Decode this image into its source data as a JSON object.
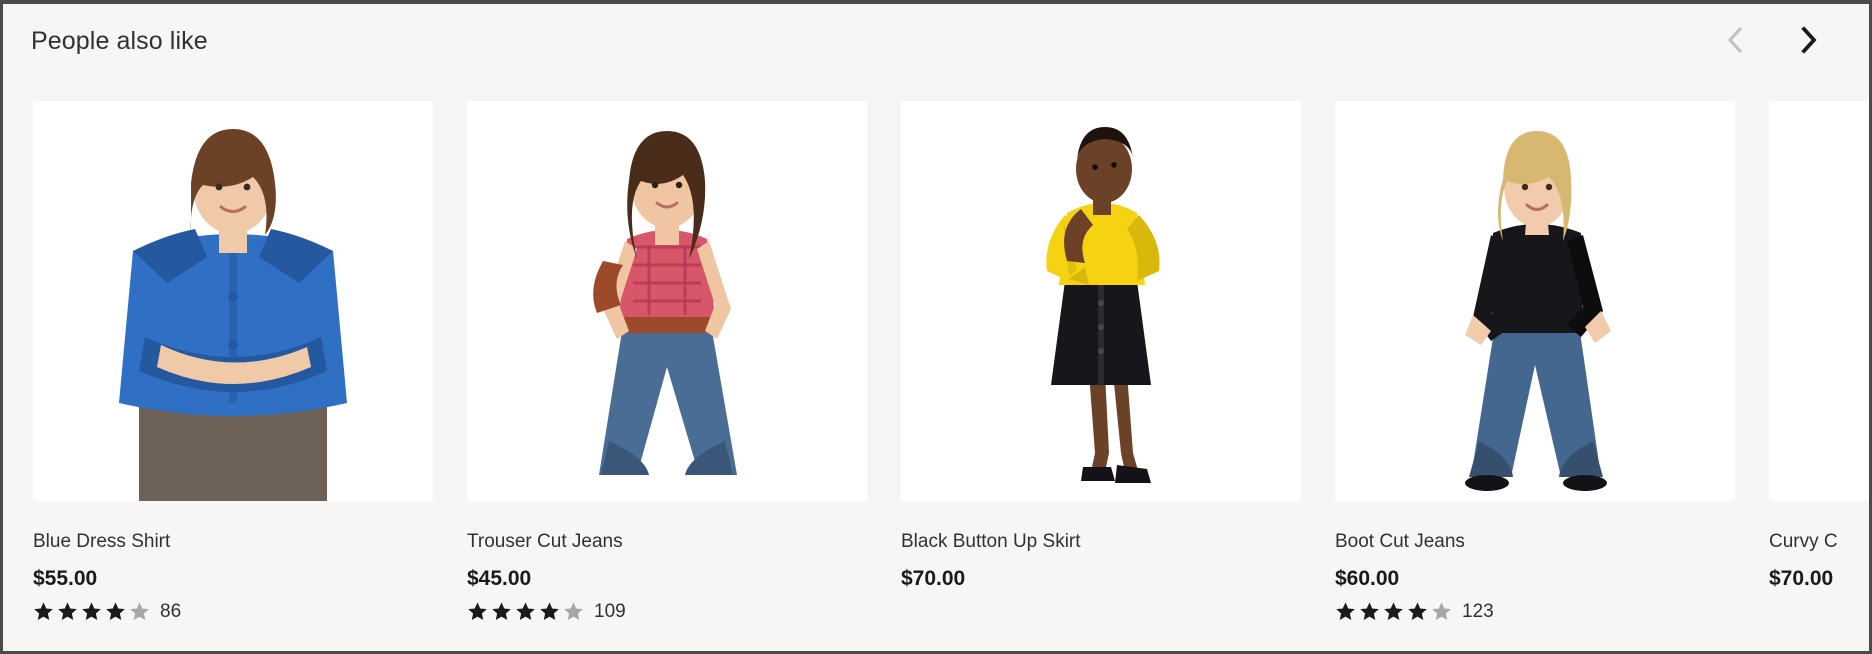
{
  "panel": {
    "title": "People also like",
    "background_color": "#f7f6f5",
    "border_color": "#4c4a48"
  },
  "nav": {
    "prev": {
      "icon": "chevron-left-icon",
      "label": "Previous",
      "enabled": false,
      "color": "#c5c3c1"
    },
    "next": {
      "icon": "chevron-right-icon",
      "label": "Next",
      "enabled": true,
      "color": "#1b1a19"
    }
  },
  "rating": {
    "max_stars": 5,
    "filled_color": "#1b1a19",
    "empty_color": "#a9a7a5"
  },
  "products": [
    {
      "name": "Blue Dress Shirt",
      "price": "$55.00",
      "stars_filled": 4,
      "review_count": "86",
      "has_rating": true,
      "image_alt": "woman in blue button-down dress shirt with arms crossed",
      "colors": {
        "garment": "#2f6fc4",
        "garment_shade": "#24589f",
        "hair": "#6b4226",
        "skin": "#f0c9a8",
        "trousers": "#6e6258"
      }
    },
    {
      "name": "Trouser Cut Jeans",
      "price": "$45.00",
      "stars_filled": 4,
      "review_count": "109",
      "has_rating": true,
      "image_alt": "woman in red checkered halter top and flared trouser cut jeans",
      "colors": {
        "garment": "#d8566a",
        "garment_shade": "#b23a50",
        "hair": "#4a2c1b",
        "skin": "#efc5a2",
        "denim": "#4a6d96",
        "denim_shade": "#3a577a",
        "belt": "#9c4a2a"
      }
    },
    {
      "name": "Black Button Up Skirt",
      "price": "$70.00",
      "stars_filled": 0,
      "review_count": "",
      "has_rating": false,
      "image_alt": "woman in yellow blouse and black button up pencil skirt with heels",
      "colors": {
        "garment": "#f5d312",
        "garment_shade": "#d9b80c",
        "hair": "#1d120c",
        "skin": "#6b4228",
        "skirt": "#17161a"
      }
    },
    {
      "name": "Boot Cut Jeans",
      "price": "$60.00",
      "stars_filled": 4,
      "review_count": "123",
      "has_rating": true,
      "image_alt": "blonde woman in black long sleeve top and boot cut jeans",
      "colors": {
        "garment": "#17161a",
        "garment_shade": "#0d0c0f",
        "hair": "#d8b871",
        "skin": "#f1cbab",
        "denim": "#44678f",
        "denim_shade": "#35506f"
      }
    },
    {
      "name": "Curvy C",
      "price": "$70.00",
      "stars_filled": 0,
      "review_count": "",
      "has_rating": false,
      "clipped": true,
      "image_alt": "partially visible product card cut off at the panel edge",
      "colors": {
        "garment": "#ffffff",
        "garment_shade": "#ffffff",
        "hair": "#ffffff",
        "skin": "#ffffff"
      }
    }
  ]
}
